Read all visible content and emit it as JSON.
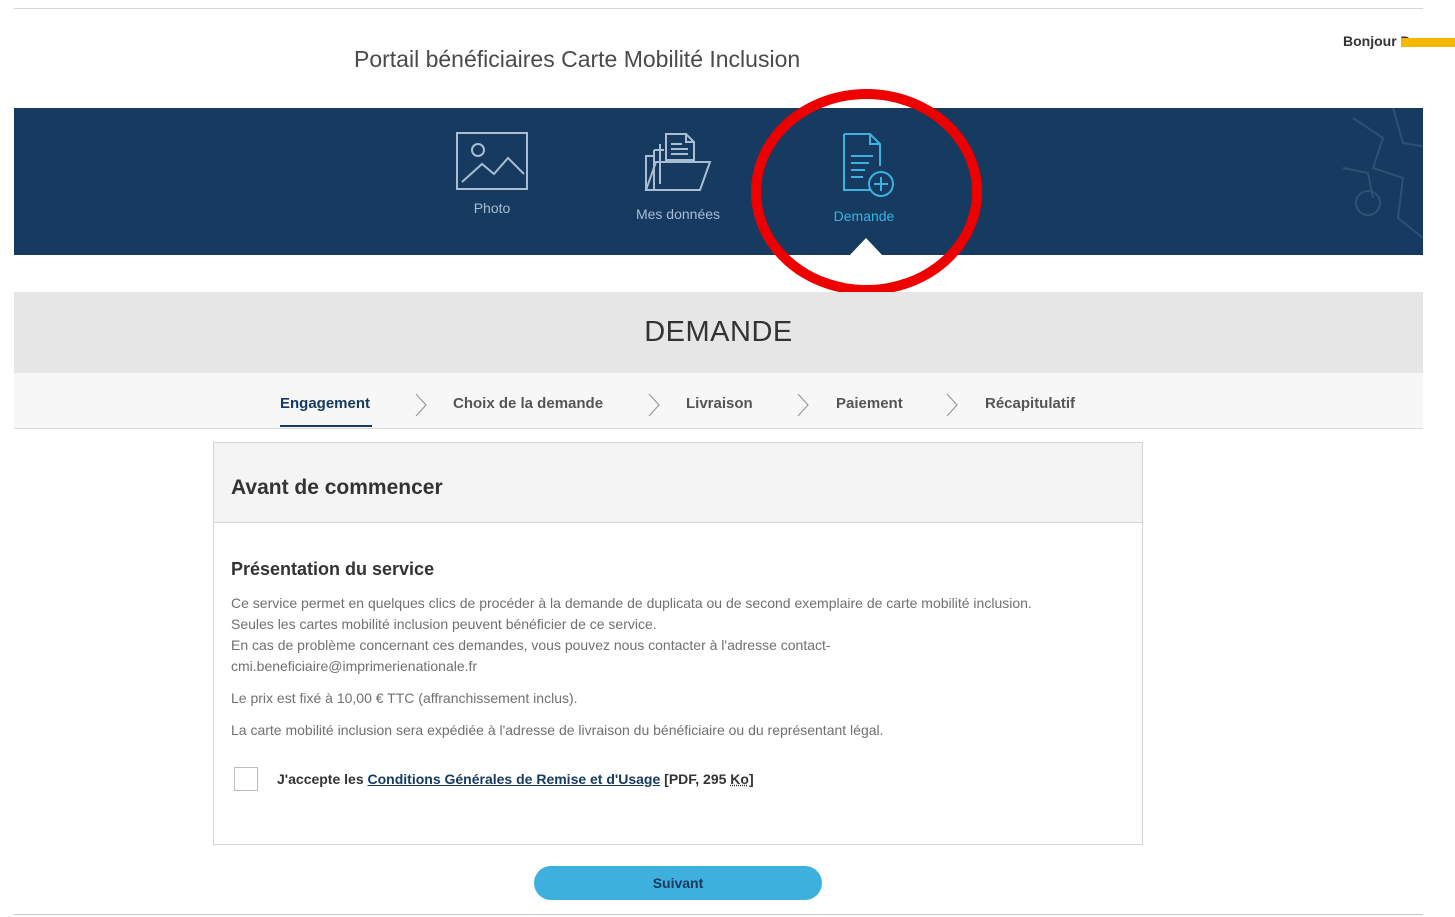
{
  "header": {
    "portal_title": "Portail bénéficiaires Carte Mobilité Inclusion",
    "greeting": "Bonjour D"
  },
  "nav": {
    "items": [
      {
        "label": "Photo",
        "icon": "image-icon",
        "active": false
      },
      {
        "label": "Mes données",
        "icon": "folder-documents-icon",
        "active": false
      },
      {
        "label": "Demande",
        "icon": "document-add-icon",
        "active": true
      }
    ]
  },
  "section": {
    "title": "DEMANDE"
  },
  "steps": [
    {
      "label": "Engagement",
      "active": true
    },
    {
      "label": "Choix de la demande",
      "active": false
    },
    {
      "label": "Livraison",
      "active": false
    },
    {
      "label": "Paiement",
      "active": false
    },
    {
      "label": "Récapitulatif",
      "active": false
    }
  ],
  "card": {
    "title": "Avant de commencer",
    "subtitle": "Présentation du service",
    "paragraph1": [
      "Ce service permet en quelques clics de procéder à la demande de duplicata ou de second exemplaire de carte mobilité inclusion.",
      "Seules les cartes mobilité inclusion peuvent bénéficier de ce service.",
      "En cas de problème concernant ces demandes, vous pouvez nous contacter à l'adresse contact-",
      "cmi.beneficiaire@imprimerienationale.fr"
    ],
    "price": "Le prix est fixé à 10,00 € TTC (affranchissement inclus).",
    "delivery": "La carte mobilité inclusion sera expédiée à l'adresse de livraison du bénéficiaire ou du représentant légal.",
    "accept": {
      "prefix": "J'accepte les ",
      "link": "Conditions Générales de Remise et d'Usage",
      "file_open": " [PDF, 295 ",
      "file_unit": "Ko",
      "file_close": "]",
      "checked": false
    }
  },
  "actions": {
    "next_label": "Suivant"
  },
  "colors": {
    "nav_band": "#163a60",
    "active_accent": "#3bb3e0",
    "button": "#3db0de",
    "highlight_ring": "#ee0000",
    "redaction": "#f5b800"
  }
}
